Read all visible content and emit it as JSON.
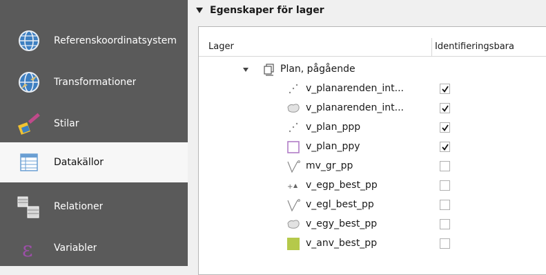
{
  "sidebar": {
    "items": [
      {
        "label": "Referenskoordinatsystem",
        "icon": "globe-icon"
      },
      {
        "label": "Transformationer",
        "icon": "globe-transform-icon"
      },
      {
        "label": "Stilar",
        "icon": "paintbrush-icon"
      },
      {
        "label": "Datakällor",
        "icon": "table-icon",
        "active": true
      },
      {
        "label": "Relationer",
        "icon": "relations-icon"
      },
      {
        "label": "Variabler",
        "icon": "epsilon-icon"
      }
    ]
  },
  "group": {
    "title": "Egenskaper för lager"
  },
  "table": {
    "headers": {
      "layer": "Lager",
      "ident": "Identifieringsbara"
    },
    "group_row": {
      "label": "Plan, pågående",
      "icon": "layer-group-icon"
    },
    "rows": [
      {
        "label": "v_planarenden_int...",
        "icon": "point-layer-icon",
        "checked": true
      },
      {
        "label": "v_planarenden_int...",
        "icon": "polygon-layer-icon",
        "checked": true
      },
      {
        "label": "v_plan_ppp",
        "icon": "point-layer-icon",
        "checked": true
      },
      {
        "label": "v_plan_ppy",
        "icon": "polygon-outline-purple-icon",
        "checked": true
      },
      {
        "label": "mv_gr_pp",
        "icon": "line-layer-icon",
        "checked": false
      },
      {
        "label": "v_egp_best_pp",
        "icon": "point-symbol-layer-icon",
        "checked": false
      },
      {
        "label": "v_egl_best_pp",
        "icon": "line-layer-icon",
        "checked": false
      },
      {
        "label": "v_egy_best_pp",
        "icon": "polygon-layer-icon",
        "checked": false
      },
      {
        "label": "v_anv_best_pp",
        "icon": "polygon-fill-green-icon",
        "checked": false
      }
    ]
  },
  "colors": {
    "sidebar_bg": "#5a5a5a",
    "active_bg": "#f7f7f7",
    "purple_outline": "#b07cc6",
    "green_fill": "#b5c94a"
  }
}
